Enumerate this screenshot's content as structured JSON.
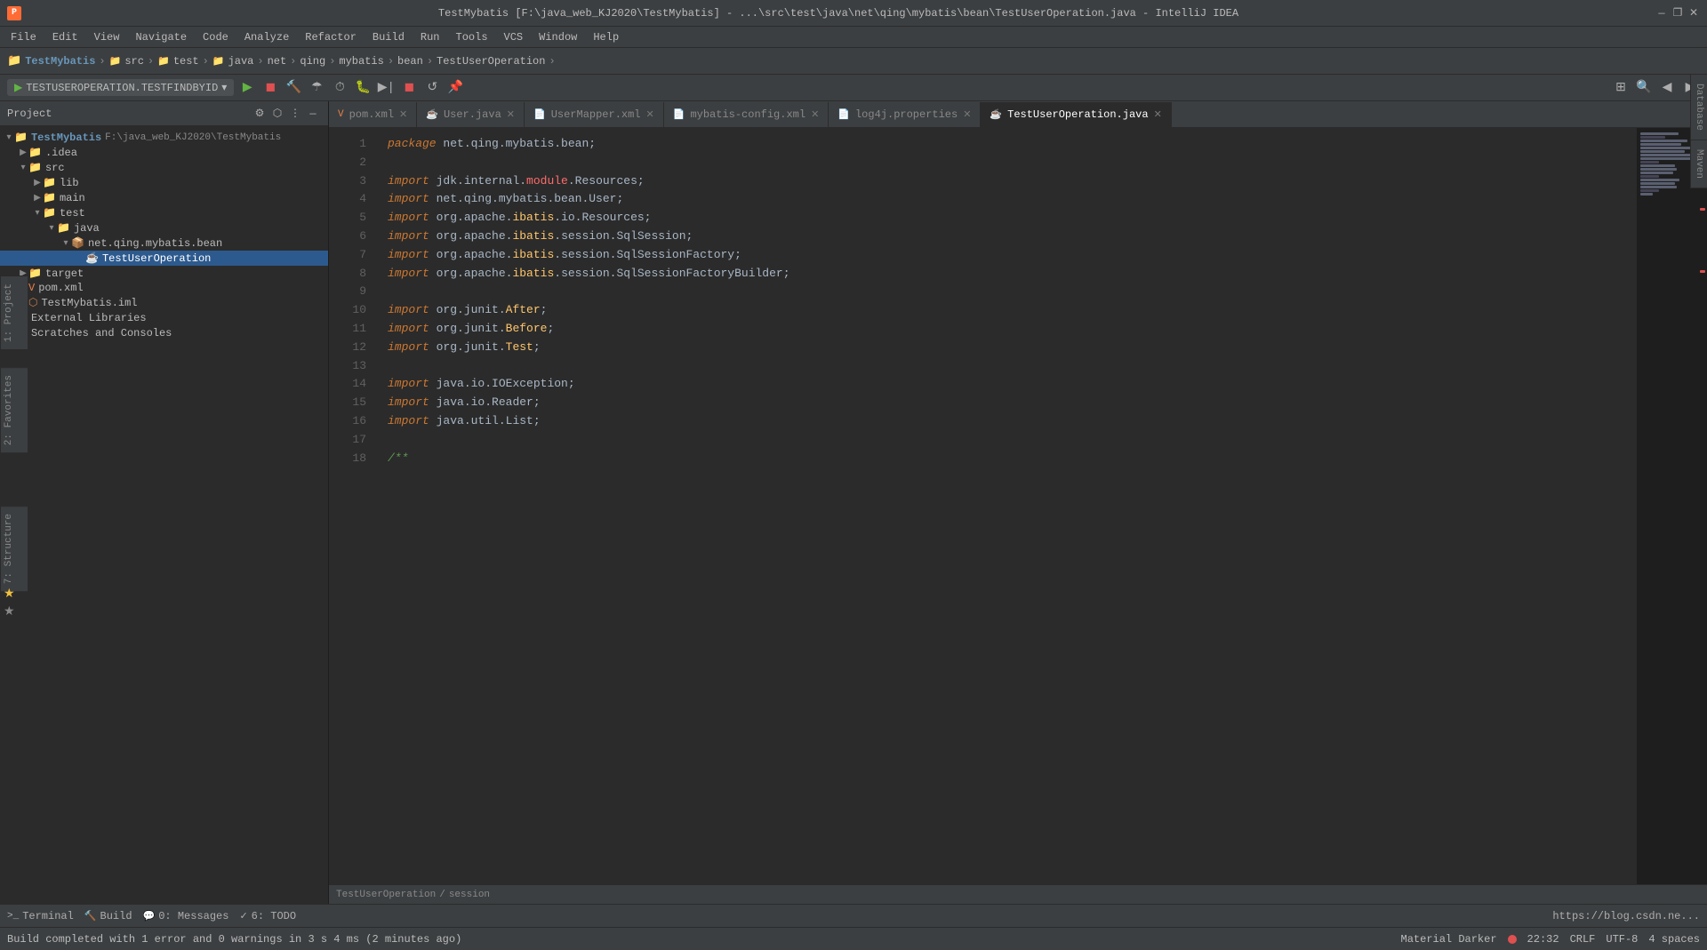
{
  "titlebar": {
    "app_icon": "P",
    "title": "TestMybatis [F:\\java_web_KJ2020\\TestMybatis] - ...\\src\\test\\java\\net\\qing\\mybatis\\bean\\TestUserOperation.java - IntelliJ IDEA",
    "minimize": "—",
    "maximize": "❐",
    "close": "✕"
  },
  "menubar": {
    "items": [
      "File",
      "Edit",
      "View",
      "Navigate",
      "Code",
      "Analyze",
      "Refactor",
      "Build",
      "Run",
      "Tools",
      "VCS",
      "Window",
      "Help"
    ]
  },
  "navbar": {
    "project": "TestMybatis",
    "sep1": ">",
    "src": "src",
    "sep2": ">",
    "test": "test",
    "sep3": ">",
    "java": "java",
    "sep4": ">",
    "net": "net",
    "sep5": ">",
    "qing": "qing",
    "sep6": ">",
    "mybatis": "mybatis",
    "sep7": ">",
    "bean": "bean",
    "sep8": ">",
    "file": "TestUserOperation",
    "sep9": ">"
  },
  "runconfig": {
    "name": "TESTUSEROPERATION.TESTFINDBYID",
    "dropdown_arrow": "▾"
  },
  "sidebar": {
    "title": "Project",
    "items": [
      {
        "label": "TestMybatis F:\\java_web_KJ2020\\TestMybatis",
        "level": 0,
        "type": "root",
        "arrow": "▾",
        "icon": "📁"
      },
      {
        "label": ".idea",
        "level": 1,
        "type": "folder",
        "arrow": "▶",
        "icon": "📁"
      },
      {
        "label": "src",
        "level": 1,
        "type": "folder",
        "arrow": "▾",
        "icon": "📁"
      },
      {
        "label": "lib",
        "level": 2,
        "type": "folder",
        "arrow": "▶",
        "icon": "📁"
      },
      {
        "label": "main",
        "level": 2,
        "type": "folder",
        "arrow": "▶",
        "icon": "📁"
      },
      {
        "label": "test",
        "level": 2,
        "type": "folder",
        "arrow": "▾",
        "icon": "📁"
      },
      {
        "label": "java",
        "level": 3,
        "type": "folder",
        "arrow": "▾",
        "icon": "📁"
      },
      {
        "label": "net.qing.mybatis.bean",
        "level": 4,
        "type": "package",
        "arrow": "▾",
        "icon": "📦"
      },
      {
        "label": "TestUserOperation",
        "level": 5,
        "type": "java",
        "arrow": "",
        "icon": "☕",
        "selected": true
      },
      {
        "label": "target",
        "level": 1,
        "type": "folder",
        "arrow": "▶",
        "icon": "📁"
      },
      {
        "label": "pom.xml",
        "level": 1,
        "type": "xml",
        "arrow": "",
        "icon": "📄"
      },
      {
        "label": "TestMybatis.iml",
        "level": 1,
        "type": "iml",
        "arrow": "",
        "icon": "📄"
      },
      {
        "label": "External Libraries",
        "level": 0,
        "type": "folder",
        "arrow": "▶",
        "icon": "📚"
      },
      {
        "label": "Scratches and Consoles",
        "level": 0,
        "type": "scratches",
        "arrow": "",
        "icon": "📝"
      }
    ]
  },
  "tabs": [
    {
      "label": "pom.xml",
      "icon": "📄",
      "active": false
    },
    {
      "label": "User.java",
      "icon": "☕",
      "active": false
    },
    {
      "label": "UserMapper.xml",
      "icon": "📄",
      "active": false
    },
    {
      "label": "mybatis-config.xml",
      "icon": "📄",
      "active": false
    },
    {
      "label": "log4j.properties",
      "icon": "📄",
      "active": false
    },
    {
      "label": "TestUserOperation.java",
      "icon": "☕",
      "active": true
    }
  ],
  "code": {
    "lines": [
      {
        "num": 1,
        "content": "package net.qing.mybatis.bean;"
      },
      {
        "num": 2,
        "content": ""
      },
      {
        "num": 3,
        "content": "import jdk.internal.module.Resources;"
      },
      {
        "num": 4,
        "content": "import net.qing.mybatis.bean.User;"
      },
      {
        "num": 5,
        "content": "import org.apache.ibatis.io.Resources;"
      },
      {
        "num": 6,
        "content": "import org.apache.ibatis.session.SqlSession;"
      },
      {
        "num": 7,
        "content": "import org.apache.ibatis.session.SqlSessionFactory;"
      },
      {
        "num": 8,
        "content": "import org.apache.ibatis.session.SqlSessionFactoryBuilder;"
      },
      {
        "num": 9,
        "content": ""
      },
      {
        "num": 10,
        "content": "import org.junit.After;"
      },
      {
        "num": 11,
        "content": "import org.junit.Before;"
      },
      {
        "num": 12,
        "content": "import org.junit.Test;"
      },
      {
        "num": 13,
        "content": ""
      },
      {
        "num": 14,
        "content": "import java.io.IOException;"
      },
      {
        "num": 15,
        "content": "import java.io.Reader;"
      },
      {
        "num": 16,
        "content": "import java.util.List;"
      },
      {
        "num": 17,
        "content": ""
      },
      {
        "num": 18,
        "content": "/**"
      }
    ]
  },
  "breadcrumb": {
    "file": "TestUserOperation",
    "sep": "/",
    "method": "session"
  },
  "statusbar": {
    "message": "Build completed with 1 error and 0 warnings in 3 s 4 ms (2 minutes ago)",
    "theme": "Material Darker",
    "time": "22:32",
    "line_ending": "CRLF",
    "encoding": "UTF-8",
    "indent": "4 spaces"
  },
  "bottomtools": [
    {
      "label": "Terminal",
      "icon": ">_",
      "num": ""
    },
    {
      "label": "Build",
      "icon": "🔨",
      "num": ""
    },
    {
      "label": "0: Messages",
      "icon": "💬",
      "num": "0"
    },
    {
      "label": "6: TODO",
      "icon": "✓",
      "num": "6"
    }
  ],
  "rightpanels": [
    "Database",
    "Maven"
  ],
  "leftpanels": [
    "1: Project",
    "2: Favorites",
    "7: Structure"
  ],
  "bottom_url": "https://blog.csdn.ne..."
}
